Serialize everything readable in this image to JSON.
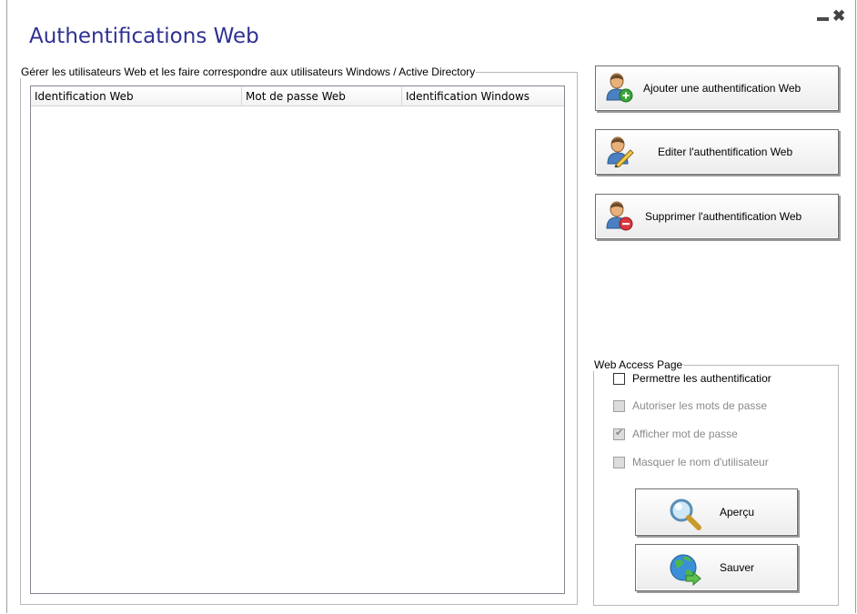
{
  "window": {
    "title": "Authentifications Web",
    "close_symbol": "✖"
  },
  "users_group": {
    "legend": "Gérer les utilisateurs Web et les faire correspondre aux utilisateurs Windows / Active Directory",
    "columns": [
      "Identification Web",
      "Mot de passe Web",
      "Identification Windows"
    ],
    "rows": []
  },
  "actions": {
    "add_label": "Ajouter une authentification Web",
    "edit_label": "Editer l'authentification Web",
    "delete_label": "Supprimer l'authentification Web"
  },
  "web_access": {
    "legend": "Web Access Page",
    "options": [
      {
        "label": "Permettre les authentificatior",
        "checked": false,
        "enabled": true
      },
      {
        "label": "Autoriser les mots de passe",
        "checked": false,
        "enabled": false
      },
      {
        "label": "Afficher mot de passe",
        "checked": true,
        "enabled": false
      },
      {
        "label": "Masquer le nom d'utilisateur",
        "checked": false,
        "enabled": false
      }
    ],
    "preview_label": "Aperçu",
    "save_label": "Sauver"
  },
  "colors": {
    "title": "#2e3192",
    "add_badge": "#3aa53a",
    "delete_badge": "#d9363e"
  },
  "icons": [
    "user-add-icon",
    "user-edit-icon",
    "user-delete-icon",
    "magnifier-icon",
    "globe-arrow-icon",
    "minimize-icon",
    "close-icon"
  ]
}
